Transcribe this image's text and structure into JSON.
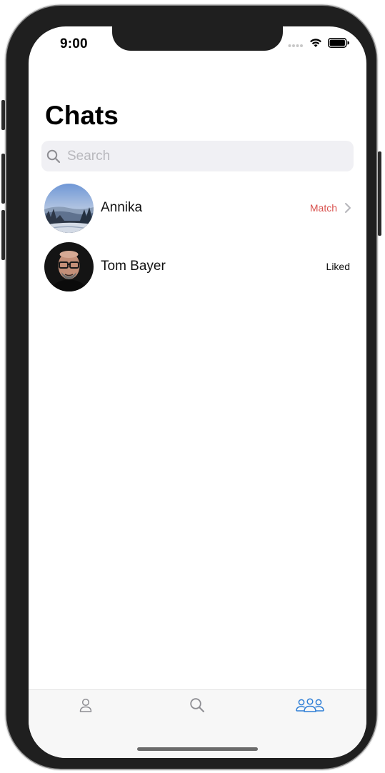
{
  "status_bar": {
    "time": "9:00"
  },
  "page": {
    "title": "Chats"
  },
  "search": {
    "placeholder": "Search",
    "value": "",
    "icon": "search-icon"
  },
  "chats": [
    {
      "name": "Annika",
      "status": "Match",
      "status_color": "#d9534f",
      "has_chevron": true,
      "avatar": "mountain-landscape-photo"
    },
    {
      "name": "Tom Bayer",
      "status": "Liked",
      "status_color": "#111111",
      "has_chevron": false,
      "avatar": "man-with-glasses-portrait"
    }
  ],
  "tab_bar": {
    "tabs": [
      {
        "icon": "person-icon",
        "active": false
      },
      {
        "icon": "search-icon",
        "active": false
      },
      {
        "icon": "people-group-icon",
        "active": true
      }
    ],
    "active_color": "#2f7fd6",
    "inactive_color": "#8e8e93"
  }
}
